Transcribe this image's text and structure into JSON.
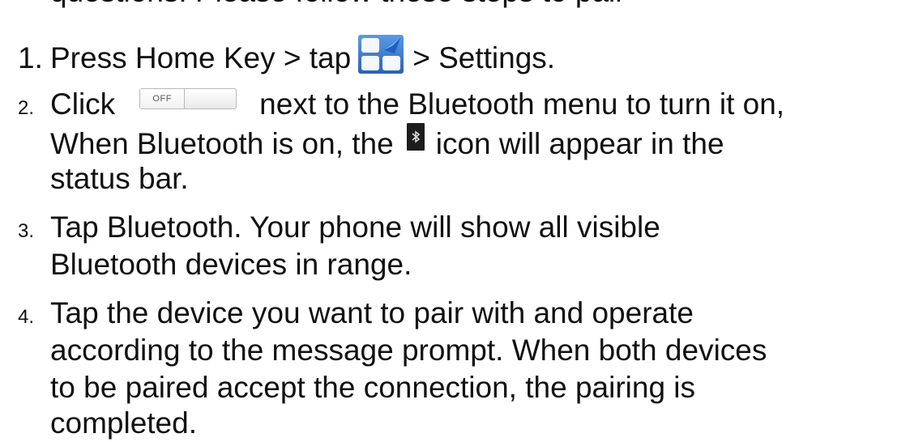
{
  "doc": {
    "clipped_top_line": "questions. Please follow these steps to pair",
    "step1": {
      "number": "1.",
      "before_icon": "Press Home Key > tap",
      "icon": "apps-grid-icon",
      "after_icon": "> Settings."
    },
    "step2": {
      "number": "2.",
      "click_word": "Click",
      "toggle_label": "OFF",
      "after_toggle": "next to the Bluetooth menu to turn it on,",
      "line2_before_icon": "When Bluetooth is on, the",
      "status_icon": "bluetooth-status-icon",
      "line2_after_icon": "icon will appear in the",
      "line3": "status bar."
    },
    "step3": {
      "number": "3.",
      "line1": "Tap Bluetooth. Your phone will show all visible",
      "line2": "Bluetooth devices in range."
    },
    "step4": {
      "number": "4.",
      "line1": "Tap the device you want to pair with and operate",
      "line2": "according to the message prompt. When both devices",
      "line3": "to be paired accept the connection, the pairing is",
      "line4": "completed."
    }
  },
  "colors": {
    "text": "#111111",
    "icon_blue": "#2f6fc4",
    "icon_blue_light": "#5a9be3",
    "status_bar_bg": "#1d1d1d"
  }
}
